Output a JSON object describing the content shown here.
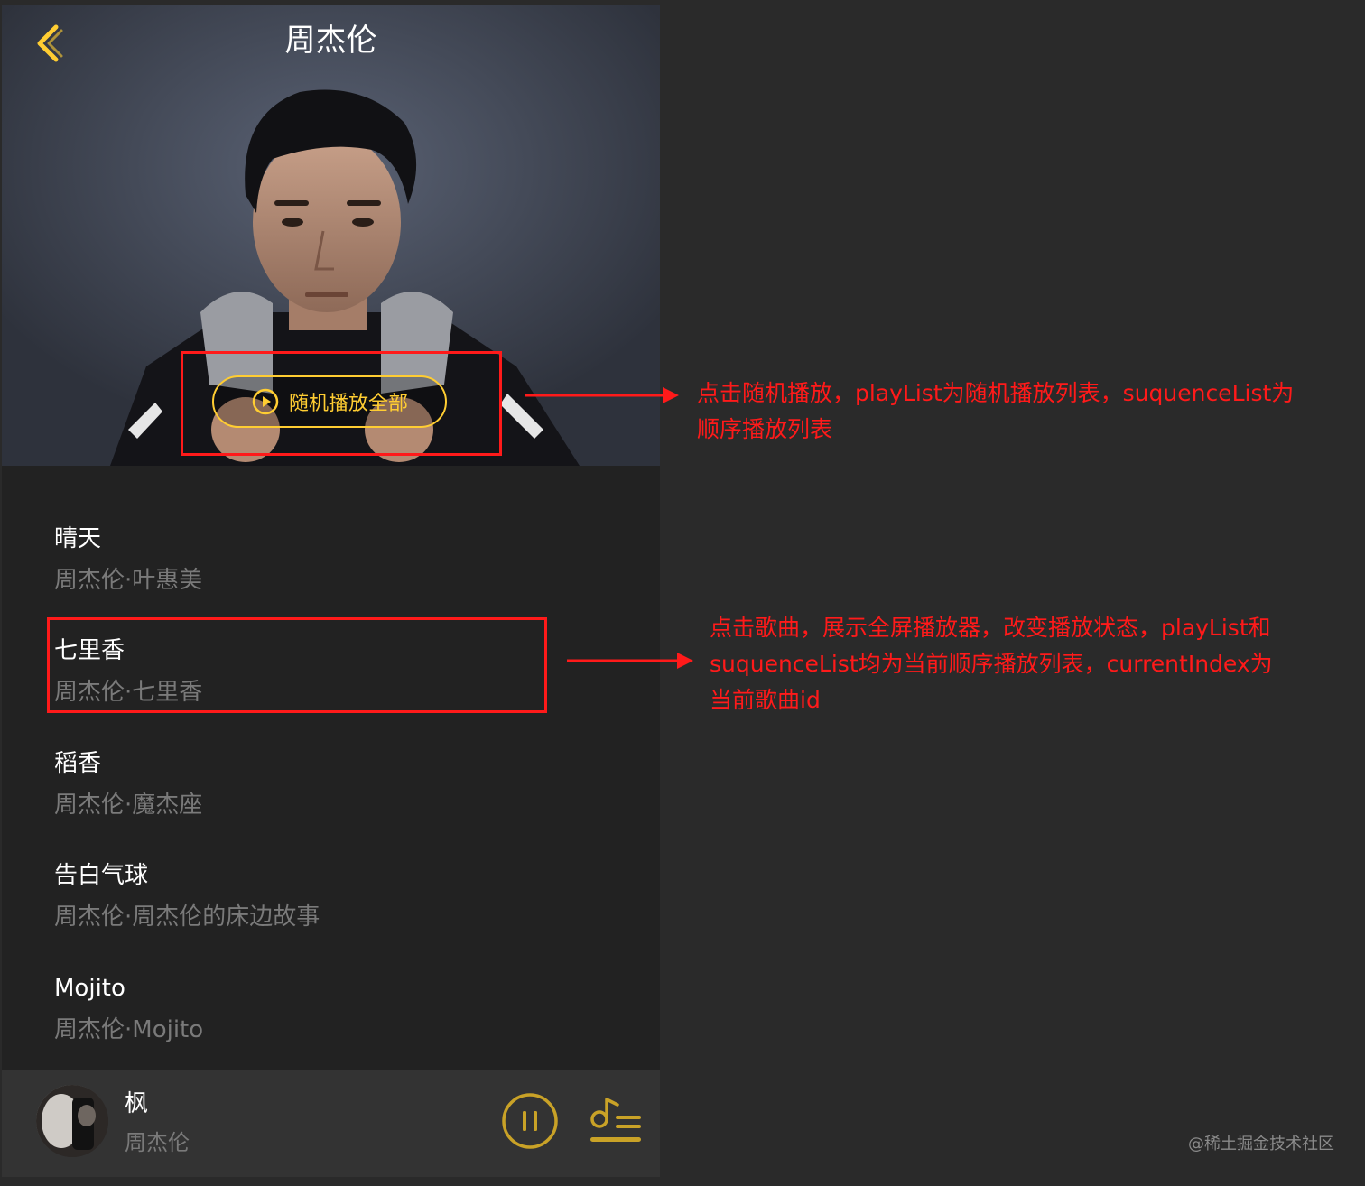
{
  "header": {
    "title": "周杰伦"
  },
  "hero": {
    "shuffle_label": "随机播放全部"
  },
  "songs": [
    {
      "name": "晴天",
      "desc": "周杰伦·叶惠美"
    },
    {
      "name": "七里香",
      "desc": "周杰伦·七里香"
    },
    {
      "name": "稻香",
      "desc": "周杰伦·魔杰座"
    },
    {
      "name": "告白气球",
      "desc": "周杰伦·周杰伦的床边故事"
    },
    {
      "name": "Mojito",
      "desc": "周杰伦·Mojito"
    }
  ],
  "mini_player": {
    "title": "枫",
    "artist": "周杰伦"
  },
  "annotations": {
    "shuffle_note_line1": "点击随机播放，playList为随机播放列表，suquenceList为",
    "shuffle_note_line2": "顺序播放列表",
    "song_note_line1": "点击歌曲，展示全屏播放器，改变播放状态，playList和",
    "song_note_line2": "suquenceList均为当前顺序播放列表，currentIndex为",
    "song_note_line3": "当前歌曲id"
  },
  "watermark": "@稀土掘金技术社区",
  "colors": {
    "accent": "#ffcd32",
    "annotation": "#ff1a1a",
    "background": "#222222",
    "secondary_text": "#7a7a7a"
  },
  "icons": {
    "back": "chevron-left-icon",
    "shuffle": "play-circle-icon",
    "pause": "pause-circle-icon",
    "playlist": "playlist-icon"
  }
}
